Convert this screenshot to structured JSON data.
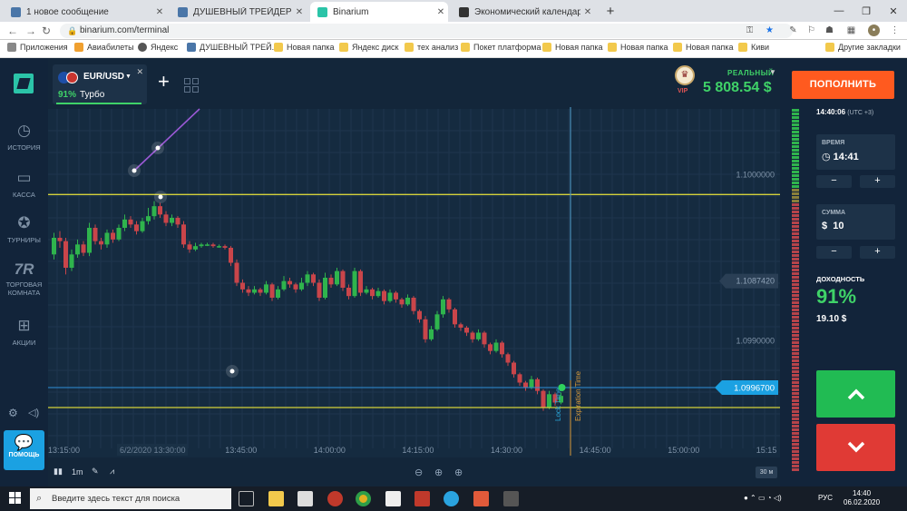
{
  "browser": {
    "tabs": [
      {
        "title": "1 новое сообщение",
        "color": "#4a76a8",
        "active": false
      },
      {
        "title": "ДУШЕВНЫЙ ТРЕЙДЕР БО | ЛТ С",
        "color": "#4a76a8",
        "active": false
      },
      {
        "title": "Binarium",
        "color": "#2bc4a8",
        "active": true
      },
      {
        "title": "Экономический календарь — И",
        "color": "#333333",
        "active": false
      }
    ],
    "url": "binarium.com/terminal",
    "bookmarks": [
      "Приложения",
      "Авиабилеты",
      "Яндекс",
      "ДУШЕВНЫЙ ТРЕЙ...",
      "Новая папка",
      "Яндекс диск",
      "тех анализ",
      "Покет платформа",
      "Новая папка",
      "Новая папка",
      "Новая папка",
      "Киви",
      "Другие закладки"
    ]
  },
  "sidebar": {
    "items": [
      {
        "label": "ИСТОРИЯ",
        "icon": "history-icon"
      },
      {
        "label": "КАССА",
        "icon": "wallet-icon"
      },
      {
        "label": "ТУРНИРЫ",
        "icon": "trophy-icon"
      },
      {
        "label": "ТОРГОВАЯ КОМНАТА",
        "icon": "trading-room-icon"
      },
      {
        "label": "АКЦИИ",
        "icon": "gift-icon"
      }
    ],
    "help_label": "ПОМОЩЬ"
  },
  "asset": {
    "pair": "EUR/USD",
    "payout": "91%",
    "mode": "Турбо"
  },
  "account": {
    "type": "РЕАЛЬНЫЙ",
    "balance": "5 808.54 $",
    "vip": "VIP"
  },
  "trade_panel": {
    "deposit_label": "ПОПОЛНИТЬ",
    "clock": "14:40:06",
    "timezone": "(UTC +3)",
    "time_label": "ВРЕМЯ",
    "time_value": "14:41",
    "amount_label": "СУММА",
    "amount_value": "10",
    "currency": "$",
    "yield_label": "ДОХОДНОСТЬ",
    "yield_pct": "91%",
    "yield_value": "19.10 $"
  },
  "chart_data": {
    "type": "candlestick",
    "y_ticks": [
      "1.1000000",
      "1.0990000"
    ],
    "x_ticks": [
      "13:15:00",
      "13:30:00",
      "13:45:00",
      "14:00:00",
      "14:15:00",
      "14:30:00",
      "14:45:00",
      "15:00:00",
      "15:15"
    ],
    "cursor_label": "6/2/2020 13:30:00",
    "current_price": "1.0996700",
    "hover_price": "1.1087420",
    "lock_label": "Lock Time",
    "expiration_label": "Expiration Time",
    "timeframe": "1m",
    "zoom_label": "30 м",
    "candles": [
      [
        1.09952,
        1.09962,
        1.09965,
        1.09949
      ],
      [
        1.09962,
        1.0996,
        1.09966,
        1.09956
      ],
      [
        1.0996,
        1.09944,
        1.09962,
        1.0994
      ],
      [
        1.09944,
        1.09952,
        1.09955,
        1.09942
      ],
      [
        1.09952,
        1.09958,
        1.09961,
        1.0995
      ],
      [
        1.09958,
        1.09953,
        1.0996,
        1.09951
      ],
      [
        1.09953,
        1.09968,
        1.09971,
        1.09951
      ],
      [
        1.09968,
        1.0996,
        1.0997,
        1.09958
      ],
      [
        1.0996,
        1.09958,
        1.09962,
        1.09955
      ],
      [
        1.09958,
        1.09965,
        1.09967,
        1.09956
      ],
      [
        1.09965,
        1.09961,
        1.09967,
        1.09959
      ],
      [
        1.09961,
        1.09968,
        1.0997,
        1.0996
      ],
      [
        1.09968,
        1.09973,
        1.09976,
        1.09966
      ],
      [
        1.09973,
        1.0997,
        1.09975,
        1.09968
      ],
      [
        1.0997,
        1.09966,
        1.09972,
        1.09964
      ],
      [
        1.09966,
        1.09972,
        1.09974,
        1.09965
      ],
      [
        1.09972,
        1.09975,
        1.0998,
        1.0997
      ],
      [
        1.09975,
        1.09981,
        1.09984,
        1.09973
      ],
      [
        1.09981,
        1.09976,
        1.09983,
        1.09974
      ],
      [
        1.09976,
        1.09971,
        1.09978,
        1.09969
      ],
      [
        1.09971,
        1.09974,
        1.09976,
        1.09969
      ],
      [
        1.09974,
        1.0997,
        1.09975,
        1.09968
      ],
      [
        1.0997,
        1.09958,
        1.09972,
        1.09956
      ],
      [
        1.09958,
        1.09955,
        1.0996,
        1.09953
      ],
      [
        1.09955,
        1.09957,
        1.09959,
        1.09954
      ],
      [
        1.09957,
        1.09958,
        1.09959,
        1.09956
      ],
      [
        1.09958,
        1.09958,
        1.09959,
        1.09957
      ],
      [
        1.09958,
        1.09957,
        1.09959,
        1.09956
      ],
      [
        1.09957,
        1.09957,
        1.09958,
        1.09956
      ],
      [
        1.09957,
        1.09956,
        1.09958,
        1.09955
      ],
      [
        1.09956,
        1.09947,
        1.09957,
        1.09945
      ],
      [
        1.09947,
        1.09935,
        1.09949,
        1.09933
      ],
      [
        1.09935,
        1.09931,
        1.09937,
        1.09929
      ],
      [
        1.09931,
        1.09929,
        1.09933,
        1.09927
      ],
      [
        1.09929,
        1.09931,
        1.09933,
        1.09928
      ],
      [
        1.09931,
        1.09929,
        1.09932,
        1.09927
      ],
      [
        1.09929,
        1.09934,
        1.09936,
        1.09928
      ],
      [
        1.09934,
        1.09926,
        1.09935,
        1.09924
      ],
      [
        1.09926,
        1.09931,
        1.09933,
        1.09925
      ],
      [
        1.09931,
        1.09936,
        1.09939,
        1.0993
      ],
      [
        1.09936,
        1.09934,
        1.09938,
        1.09932
      ],
      [
        1.09934,
        1.09931,
        1.09935,
        1.09929
      ],
      [
        1.09931,
        1.09935,
        1.09938,
        1.0993
      ],
      [
        1.09935,
        1.0994,
        1.09942,
        1.09933
      ],
      [
        1.0994,
        1.09935,
        1.09941,
        1.09933
      ],
      [
        1.09935,
        1.09926,
        1.09937,
        1.09924
      ],
      [
        1.09926,
        1.09938,
        1.09941,
        1.09925
      ],
      [
        1.09938,
        1.09934,
        1.0994,
        1.09932
      ],
      [
        1.09934,
        1.09942,
        1.09944,
        1.09933
      ],
      [
        1.09942,
        1.09932,
        1.09943,
        1.0993
      ],
      [
        1.09932,
        1.09927,
        1.09934,
        1.09925
      ],
      [
        1.09927,
        1.09942,
        1.09944,
        1.09926
      ],
      [
        1.09942,
        1.09929,
        1.09943,
        1.09927
      ],
      [
        1.09929,
        1.09931,
        1.09933,
        1.09928
      ],
      [
        1.09931,
        1.09927,
        1.09932,
        1.09925
      ],
      [
        1.09927,
        1.0993,
        1.09932,
        1.09926
      ],
      [
        1.0993,
        1.09924,
        1.09931,
        1.09922
      ],
      [
        1.09924,
        1.09929,
        1.09931,
        1.09923
      ],
      [
        1.09929,
        1.09925,
        1.0993,
        1.09923
      ],
      [
        1.09925,
        1.09922,
        1.09926,
        1.0992
      ],
      [
        1.09922,
        1.09926,
        1.09928,
        1.09921
      ],
      [
        1.09926,
        1.09918,
        1.09927,
        1.09916
      ],
      [
        1.09918,
        1.09913,
        1.09919,
        1.09911
      ],
      [
        1.09913,
        1.09901,
        1.09915,
        1.09899
      ],
      [
        1.09901,
        1.09907,
        1.09909,
        1.099
      ],
      [
        1.09907,
        1.09916,
        1.09918,
        1.09906
      ],
      [
        1.09916,
        1.09925,
        1.09927,
        1.09914
      ],
      [
        1.09925,
        1.09919,
        1.09926,
        1.09917
      ],
      [
        1.09919,
        1.0991,
        1.0992,
        1.09908
      ],
      [
        1.0991,
        1.09908,
        1.09911,
        1.09906
      ],
      [
        1.09908,
        1.09905,
        1.09909,
        1.09903
      ],
      [
        1.09905,
        1.09901,
        1.09906,
        1.09899
      ],
      [
        1.09901,
        1.09905,
        1.09907,
        1.099
      ],
      [
        1.09905,
        1.09898,
        1.09906,
        1.09896
      ],
      [
        1.09898,
        1.09894,
        1.09899,
        1.09892
      ],
      [
        1.09894,
        1.09899,
        1.09901,
        1.09893
      ],
      [
        1.09899,
        1.09892,
        1.099,
        1.0989
      ],
      [
        1.09892,
        1.09887,
        1.09893,
        1.09885
      ],
      [
        1.09887,
        1.0988,
        1.09888,
        1.09878
      ],
      [
        1.0988,
        1.09875,
        1.09881,
        1.09873
      ],
      [
        1.09875,
        1.09872,
        1.09876,
        1.0987
      ],
      [
        1.09872,
        1.09877,
        1.09879,
        1.09871
      ],
      [
        1.09877,
        1.0987,
        1.09878,
        1.09868
      ],
      [
        1.0987,
        1.0986,
        1.09871,
        1.09858
      ],
      [
        1.0986,
        1.09868,
        1.0987,
        1.09859
      ],
      [
        1.09868,
        1.09863,
        1.09869,
        1.09861
      ],
      [
        1.09863,
        1.09867,
        1.09869,
        1.09862
      ]
    ]
  }
}
